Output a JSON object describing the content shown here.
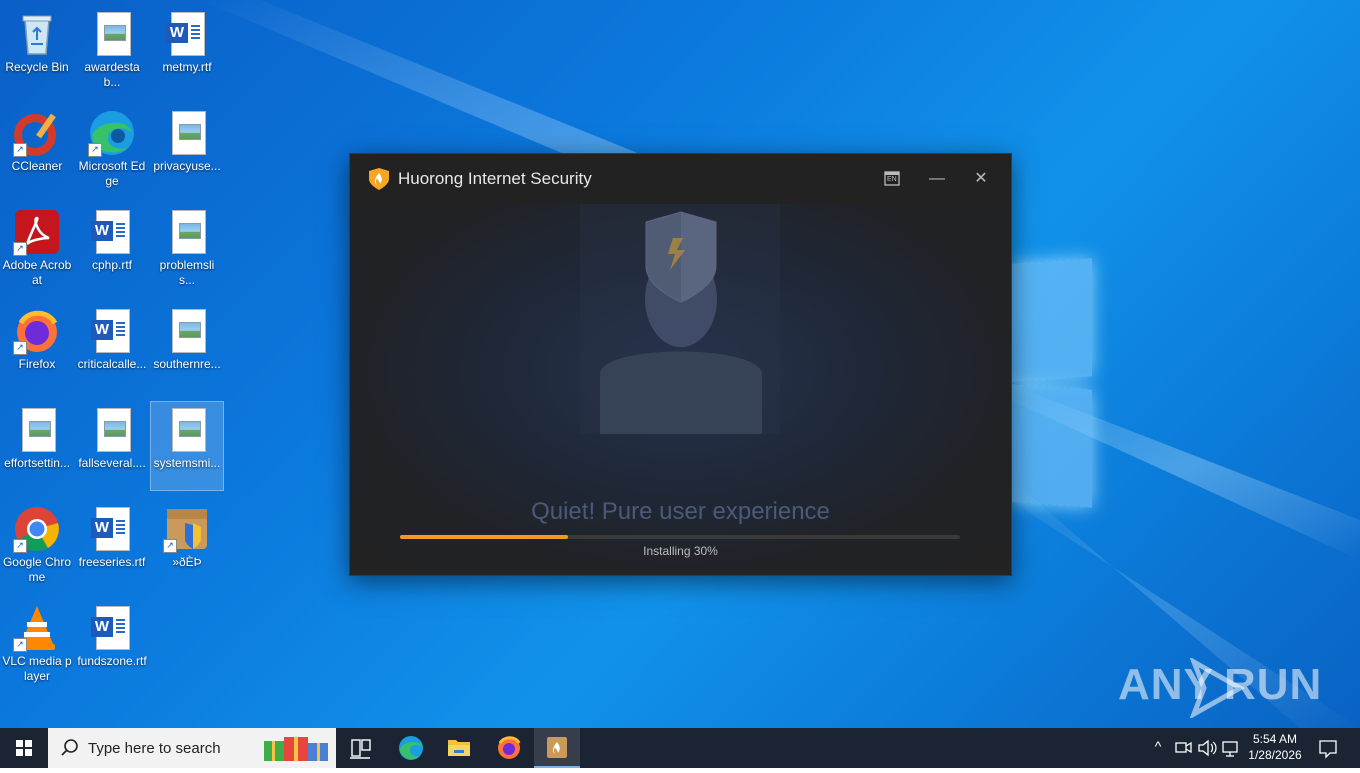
{
  "desktop": {
    "icons": [
      {
        "label": "Recycle Bin",
        "icon": "recycle-bin-icon"
      },
      {
        "label": "awardestab...",
        "icon": "image-file-icon"
      },
      {
        "label": "metmy.rtf",
        "icon": "word-document-icon"
      },
      {
        "label": "CCleaner",
        "icon": "ccleaner-icon"
      },
      {
        "label": "Microsoft Edge",
        "icon": "edge-icon"
      },
      {
        "label": "privacyuse...",
        "icon": "image-file-icon"
      },
      {
        "label": "Adobe Acrobat",
        "icon": "acrobat-icon"
      },
      {
        "label": "cphp.rtf",
        "icon": "word-document-icon"
      },
      {
        "label": "problemslis...",
        "icon": "image-file-icon"
      },
      {
        "label": "Firefox",
        "icon": "firefox-icon"
      },
      {
        "label": "criticalcalle...",
        "icon": "word-document-icon"
      },
      {
        "label": "southernre...",
        "icon": "image-file-icon"
      },
      {
        "label": "effortsettin...",
        "icon": "image-file-icon"
      },
      {
        "label": "fallseveral....",
        "icon": "image-file-icon"
      },
      {
        "label": "systemsmi...",
        "icon": "image-file-icon"
      },
      {
        "label": "Google Chrome",
        "icon": "chrome-icon"
      },
      {
        "label": "freeseries.rtf",
        "icon": "word-document-icon"
      },
      {
        "label": "»ðÈÞ",
        "icon": "installer-package-icon"
      },
      {
        "label": "VLC media player",
        "icon": "vlc-icon"
      },
      {
        "label": "fundszone.rtf",
        "icon": "word-document-icon"
      }
    ]
  },
  "installer": {
    "title": "Huorong Internet Security",
    "language_button": "EN",
    "tagline": "Quiet! Pure user experience",
    "progress_percent": 30,
    "status": "Installing 30%"
  },
  "taskbar": {
    "search_placeholder": "Type here to search",
    "clock_time": "5:54 AM",
    "clock_date": "1/28/2026"
  },
  "watermark": {
    "left": "ANY",
    "right": "RUN"
  },
  "colors": {
    "progress": "#f29a1e",
    "window_bg": "#222222",
    "desktop_blue": "#0b78dd",
    "taskbar": "#1b2433"
  }
}
